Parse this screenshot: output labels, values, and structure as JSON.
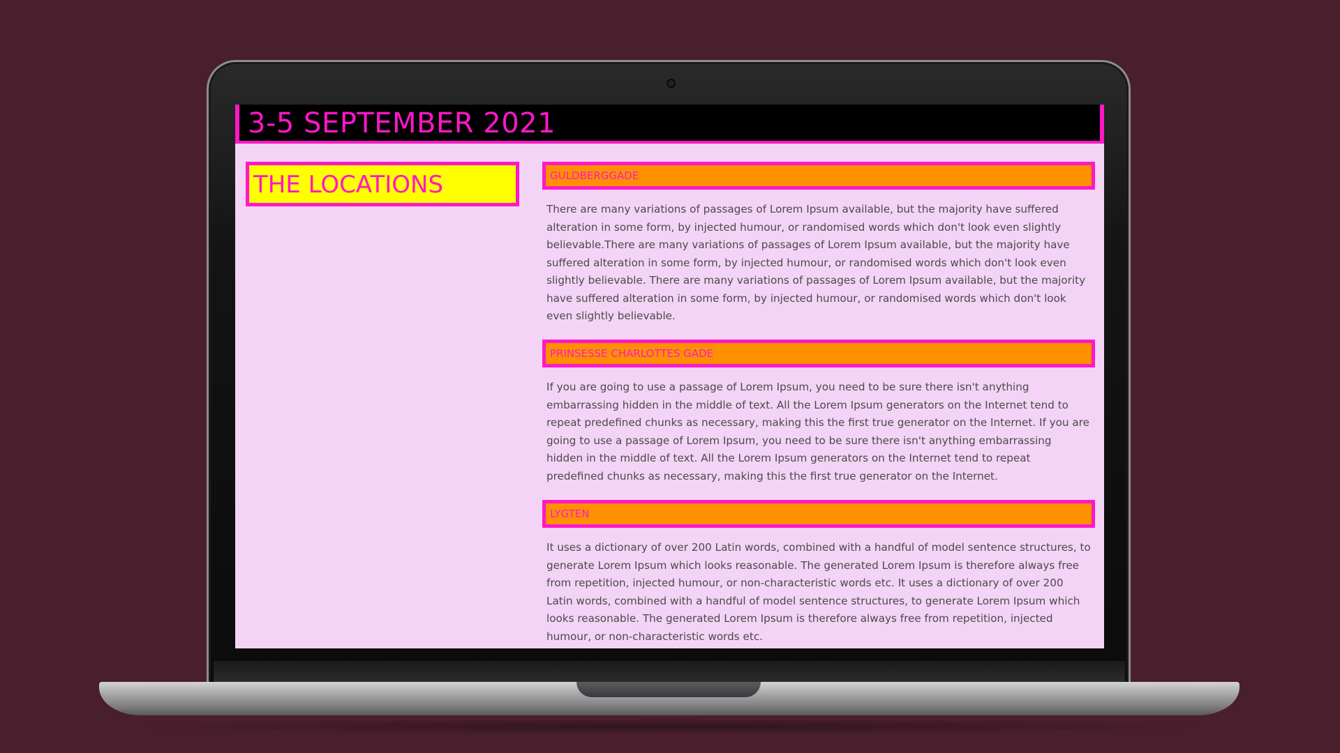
{
  "site": {
    "title": "3-5 SEPTEMBER 2021",
    "sidebar_title": "THE LOCATIONS"
  },
  "locations": [
    {
      "name": "GULDBERGGADE",
      "description": "There are many variations of passages of Lorem Ipsum available, but the majority have suffered alteration in some form, by injected humour, or randomised words which don't look even slightly believable.There are many variations of passages of Lorem Ipsum available, but the majority have suffered alteration in some form, by injected humour, or randomised words which don't look even slightly believable. There are many variations of passages of Lorem Ipsum available, but the majority have suffered alteration in some form, by injected humour, or randomised words which don't look even slightly believable."
    },
    {
      "name": "PRINSESSE CHARLOTTES GADE",
      "description": "If you are going to use a passage of Lorem Ipsum, you need to be sure there isn't anything embarrassing hidden in the middle of text. All the Lorem Ipsum generators on the Internet tend to repeat predefined chunks as necessary, making this the first true generator on the Internet. If you are going to use a passage of Lorem Ipsum, you need to be sure there isn't anything embarrassing hidden in the middle of text. All the Lorem Ipsum generators on the Internet tend to repeat predefined chunks as necessary, making this the first true generator on the Internet."
    },
    {
      "name": "LYGTEN",
      "description": "It uses a dictionary of over 200 Latin words, combined with a handful of model sentence structures, to generate Lorem Ipsum which looks reasonable. The generated Lorem Ipsum is therefore always free from repetition, injected humour, or non-characteristic words etc. It uses a dictionary of over 200 Latin words, combined with a handful of model sentence structures, to generate Lorem Ipsum which looks reasonable. The generated Lorem Ipsum is therefore always free from repetition, injected humour, or non-characteristic words etc."
    }
  ],
  "colors": {
    "background": "#4a1f2d",
    "page": "#f4d4f6",
    "accent_pink": "#ff17c8",
    "heading_orange": "#ff9000",
    "title_yellow": "#ffff00",
    "header_black": "#000000",
    "body_text": "#4a4a4a"
  }
}
